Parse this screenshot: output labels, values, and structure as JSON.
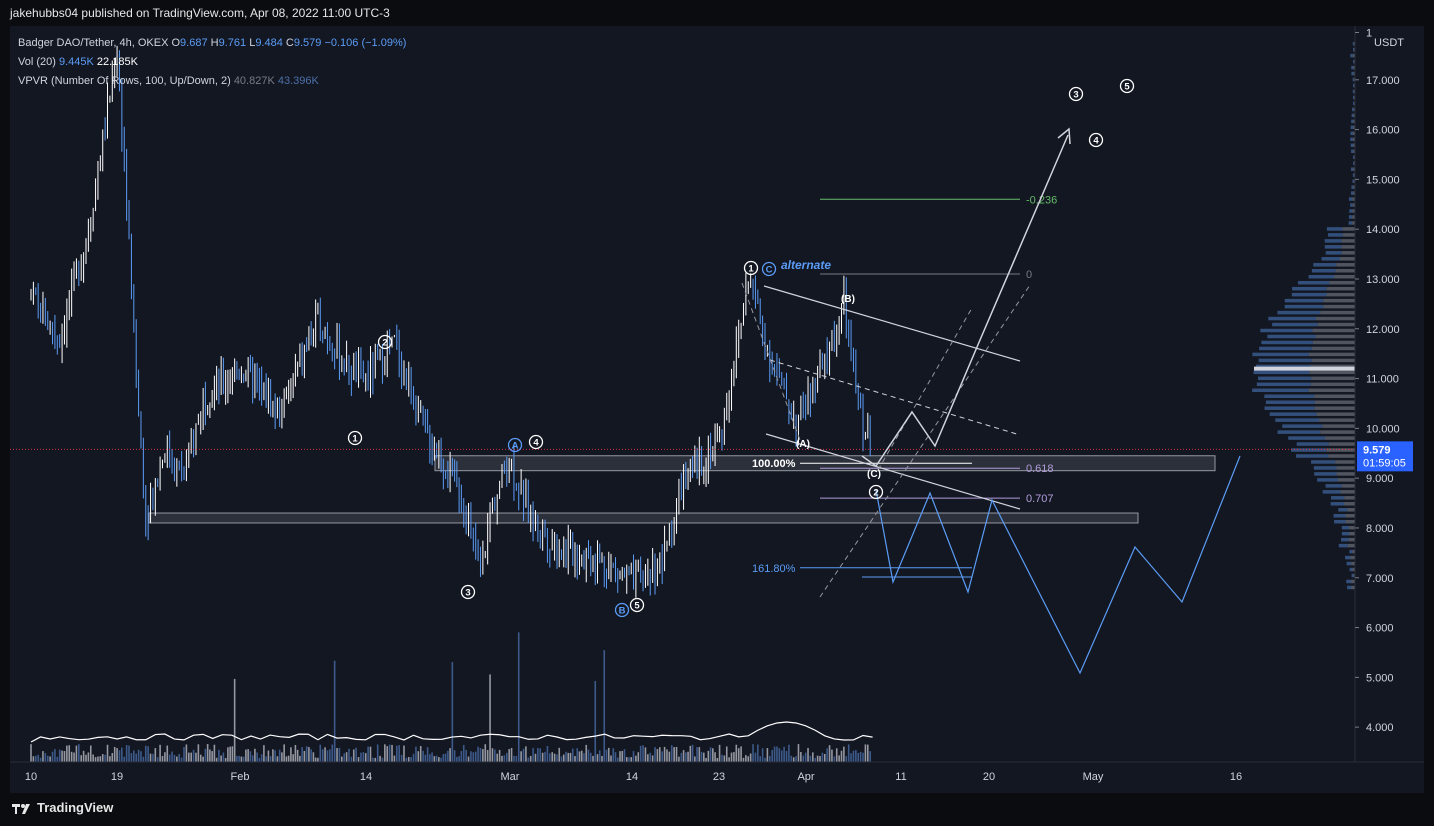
{
  "header": {
    "publisher_line": "jakehubbs04 published on TradingView.com, Apr 08, 2022 11:00 UTC-3"
  },
  "legend": {
    "symbol": "Badger DAO/Tether, 4h, OKEX",
    "o_label": "O",
    "o": "9.687",
    "h_label": "H",
    "h": "9.761",
    "l_label": "L",
    "l": "9.484",
    "c_label": "C",
    "c": "9.579",
    "change": "−0.106 (−1.09%)",
    "vol_label": "Vol (20)",
    "vol_1": "9.445K",
    "vol_2": "22.185K",
    "vpvr_label": "VPVR (Number Of Rows, 100, Up/Down, 2)",
    "vpvr_1": "40.827K",
    "vpvr_2": "43.396K"
  },
  "price_axis": {
    "currency": "USDT",
    "last_price": "9.579",
    "countdown": "01:59:05"
  },
  "footer": {
    "brand": "TradingView"
  },
  "colors": {
    "background": "#131722",
    "accent_blue": "#5b9cf6",
    "zone": "#2a2e39",
    "fib_green": "#66bb6a",
    "fib_purple": "#b39ddb",
    "last_price": "#2962ff"
  },
  "chart_data": {
    "type": "line",
    "title": "",
    "ylim": [
      3.3,
      18.0
    ],
    "x_ticks": [
      "10",
      "19",
      "Feb",
      "14",
      "Mar",
      "14",
      "23",
      "Apr",
      "11",
      "20",
      "May",
      "16"
    ],
    "y_ticks": [
      "1",
      "17.000",
      "16.000",
      "15.000",
      "14.000",
      "13.000",
      "12.000",
      "11.000",
      "10.000",
      "9.000",
      "8.000",
      "7.000",
      "6.000",
      "5.000",
      "4.000"
    ],
    "price_path": [
      {
        "t": "Jan 10",
        "p": 12.6
      },
      {
        "t": "Jan 13",
        "p": 11.8
      },
      {
        "t": "Jan 16",
        "p": 14.0
      },
      {
        "t": "Jan 19",
        "p": 17.6
      },
      {
        "t": "Jan 20",
        "p": 14.5
      },
      {
        "t": "Jan 21",
        "p": 11.0
      },
      {
        "t": "Jan 22",
        "p": 8.2
      },
      {
        "t": "Jan 24",
        "p": 9.6
      },
      {
        "t": "Jan 26",
        "p": 9.0
      },
      {
        "t": "Jan 28",
        "p": 10.6
      },
      {
        "t": "Feb 1",
        "p": 11.2
      },
      {
        "t": "Feb 5",
        "p": 10.3
      },
      {
        "t": "Feb 9",
        "p": 12.2
      },
      {
        "t": "Feb 12",
        "p": 11.2
      },
      {
        "t": "Feb 14",
        "p": 11.0
      },
      {
        "t": "Feb 17",
        "p": 11.7
      },
      {
        "t": "Feb 20",
        "p": 10.0
      },
      {
        "t": "Feb 24",
        "p": 8.7
      },
      {
        "t": "Feb 26",
        "p": 7.0
      },
      {
        "t": "Feb 27",
        "p": 8.3
      },
      {
        "t": "Mar 1",
        "p": 9.4
      },
      {
        "t": "Mar 3",
        "p": 8.3
      },
      {
        "t": "Mar 6",
        "p": 7.6
      },
      {
        "t": "Mar 10",
        "p": 7.4
      },
      {
        "t": "Mar 14",
        "p": 6.9
      },
      {
        "t": "Mar 17",
        "p": 7.3
      },
      {
        "t": "Mar 19",
        "p": 8.8
      },
      {
        "t": "Mar 23",
        "p": 9.8
      },
      {
        "t": "Mar 25",
        "p": 11.8
      },
      {
        "t": "Mar 26",
        "p": 13.1
      },
      {
        "t": "Mar 28",
        "p": 11.6
      },
      {
        "t": "Mar 31",
        "p": 10.1
      },
      {
        "t": "Apr 3",
        "p": 11.3
      },
      {
        "t": "Apr 5",
        "p": 12.5
      },
      {
        "t": "Apr 6",
        "p": 11.1
      },
      {
        "t": "Apr 7",
        "p": 10.0
      },
      {
        "t": "Apr 8",
        "p": 9.58
      }
    ],
    "annotations": {
      "alternate_label": "alternate",
      "wave_labels": [
        "1",
        "2",
        "3",
        "4",
        "5",
        "A",
        "B",
        "C",
        "(A)",
        "(B)",
        "(C)"
      ],
      "fib_levels": [
        {
          "label": "-0.236",
          "value": 14.6
        },
        {
          "label": "0",
          "value": 13.1
        },
        {
          "label": "100.00%",
          "value": 9.3
        },
        {
          "label": "0.618",
          "value": 9.2
        },
        {
          "label": "0.707",
          "value": 8.6
        },
        {
          "label": "161.80%",
          "value": 7.2
        }
      ],
      "zones": [
        {
          "from": 9.15,
          "to": 9.45
        },
        {
          "from": 8.1,
          "to": 8.3
        }
      ]
    }
  }
}
